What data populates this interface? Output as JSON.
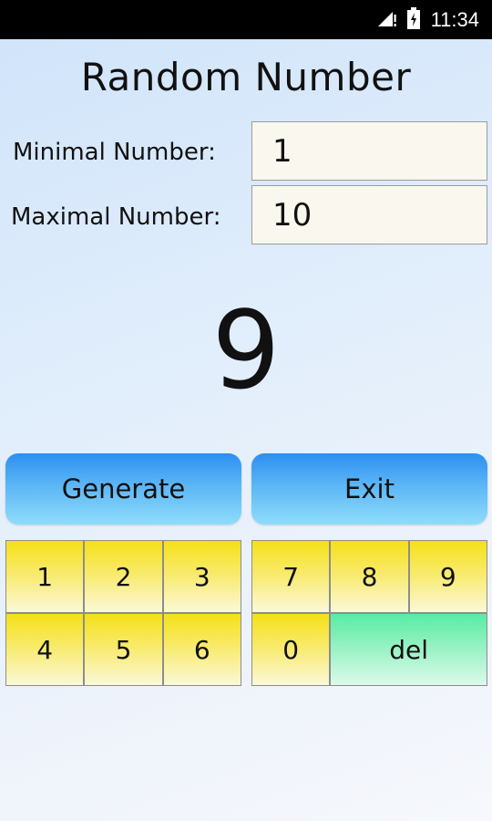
{
  "status_bar": {
    "time": "11:34",
    "icons": [
      "signal-icon",
      "battery-charging-icon"
    ]
  },
  "title": "Random Number",
  "min_label": "Minimal Number:",
  "min_value": "1",
  "max_label": "Maximal Number:",
  "max_value": "10",
  "result": "9",
  "buttons": {
    "generate": "Generate",
    "exit": "Exit"
  },
  "keypad_left": [
    "1",
    "2",
    "3",
    "4",
    "5",
    "6"
  ],
  "keypad_right": [
    "7",
    "8",
    "9",
    "0"
  ],
  "del_label": "del"
}
